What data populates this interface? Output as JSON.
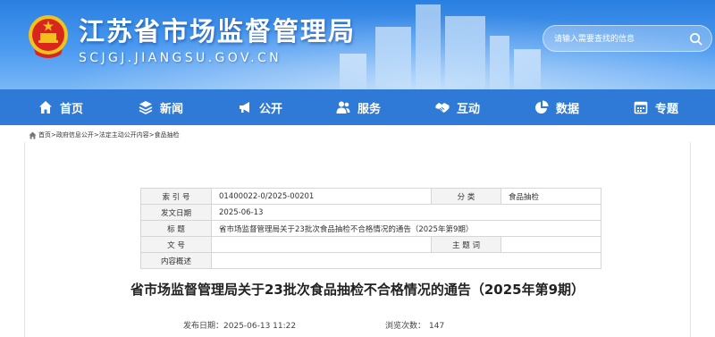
{
  "header": {
    "site_title": "江苏省市场监督管理局",
    "site_domain": "SCJGJ.JIANGSU.GOV.CN",
    "search_placeholder": "请输入需要查找的信息"
  },
  "nav": {
    "items": [
      {
        "label": "首页",
        "icon": "home-icon"
      },
      {
        "label": "新闻",
        "icon": "layers-icon"
      },
      {
        "label": "公开",
        "icon": "megaphone-icon"
      },
      {
        "label": "服务",
        "icon": "people-icon"
      },
      {
        "label": "互动",
        "icon": "handshake-icon"
      },
      {
        "label": "数据",
        "icon": "pie-chart-icon"
      },
      {
        "label": "专题",
        "icon": "calendar-icon"
      }
    ]
  },
  "breadcrumb": "首页>政府信息公开>法定主动公开内容>食品抽检",
  "info": {
    "index_label": "索 引 号",
    "index_value": "01400022-0/2025-00201",
    "category_label": "分 类",
    "category_value": "食品抽检",
    "date_label": "发文日期",
    "date_value": "2025-06-13",
    "title_label": "标 题",
    "title_value": "省市场监督管理局关于23批次食品抽检不合格情况的通告（2025年第9期）",
    "docno_label": "文 号",
    "docno_value": "",
    "keywords_label": "主 题 词",
    "keywords_value": "",
    "summary_label": "内容概述",
    "summary_value": ""
  },
  "article": {
    "title": "省市场监督管理局关于23批次食品抽检不合格情况的通告（2025年第9期）",
    "publish_label": "发布日期：",
    "publish_value": "2025-06-13 11:22",
    "views_label": "浏览次数：",
    "views_value": "147"
  },
  "colors": {
    "header_blue": "#2a7fe0",
    "nav_blue": "#2e7ad6",
    "emblem_red": "#d8261c",
    "emblem_gold": "#f2c21b"
  }
}
